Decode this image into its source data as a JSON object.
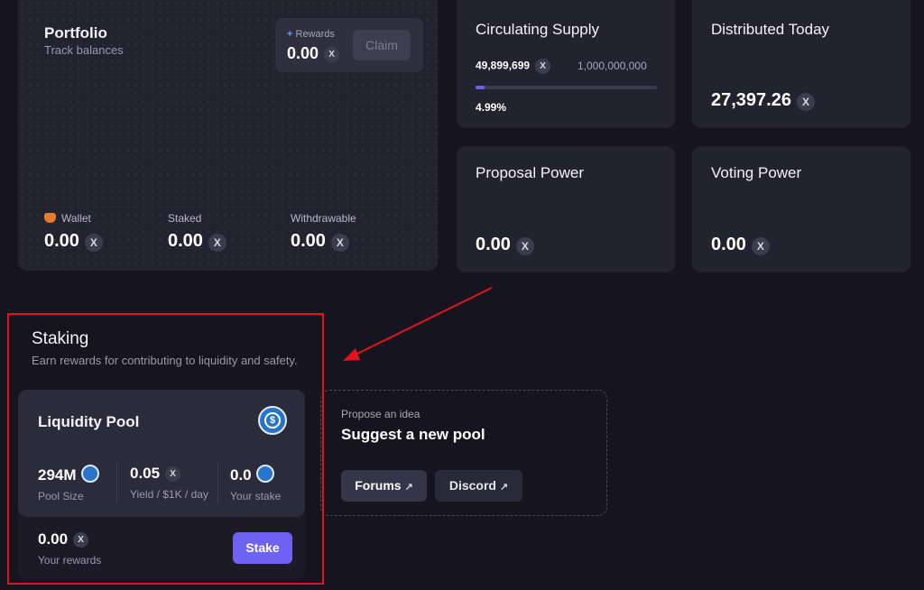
{
  "portfolio": {
    "title": "Portfolio",
    "subtitle": "Track balances",
    "rewards_label": "Rewards",
    "rewards_value": "0.00",
    "claim_label": "Claim",
    "wallet_label": "Wallet",
    "wallet_value": "0.00",
    "staked_label": "Staked",
    "staked_value": "0.00",
    "withdrawable_label": "Withdrawable",
    "withdrawable_value": "0.00"
  },
  "supply": {
    "title": "Circulating Supply",
    "circulating": "49,899,699",
    "total": "1,000,000,000",
    "percent_label": "4.99%",
    "percent_value": 4.99
  },
  "distributed": {
    "title": "Distributed Today",
    "value": "27,397.26"
  },
  "proposal": {
    "title": "Proposal Power",
    "value": "0.00"
  },
  "voting": {
    "title": "Voting Power",
    "value": "0.00"
  },
  "staking": {
    "title": "Staking",
    "subtitle": "Earn rewards for contributing to liquidity and safety.",
    "pool": {
      "title": "Liquidity Pool",
      "pool_size_value": "294M",
      "pool_size_label": "Pool Size",
      "yield_value": "0.05",
      "yield_label": "Yield / $1K / day",
      "stake_value": "0.0",
      "stake_label": "Your stake",
      "rewards_value": "0.00",
      "rewards_label": "Your rewards",
      "stake_button": "Stake"
    },
    "suggest": {
      "kicker": "Propose an idea",
      "title": "Suggest a new pool",
      "forums": "Forums",
      "discord": "Discord"
    }
  },
  "colors": {
    "accent": "#6e62f3",
    "highlight": "#e0141b",
    "background": "#15141f",
    "card": "#23222f"
  }
}
